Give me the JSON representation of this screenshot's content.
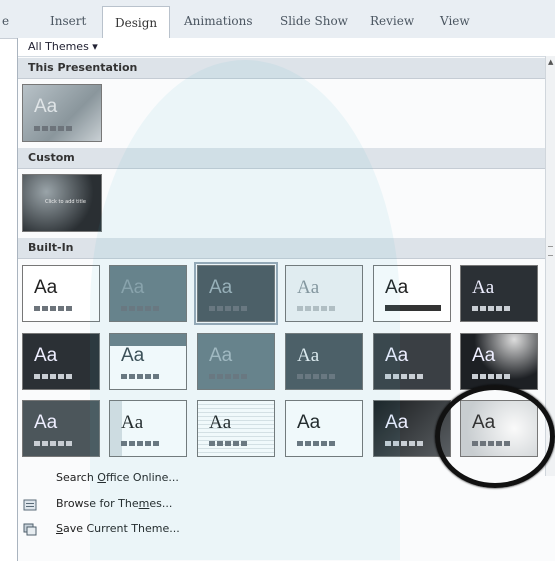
{
  "ribbon": {
    "tabs": [
      {
        "label": "e"
      },
      {
        "label": "Insert"
      },
      {
        "label": "Design",
        "active": true
      },
      {
        "label": "Animations"
      },
      {
        "label": "Slide Show"
      },
      {
        "label": "Review"
      },
      {
        "label": "View"
      }
    ]
  },
  "gallery": {
    "filter_label": "All Themes ▾",
    "sections": {
      "this_presentation": "This Presentation",
      "custom": "Custom",
      "built_in": "Built-In"
    },
    "thumb_label": "Aa",
    "custom_thumb_text": "Click to add title"
  },
  "menu": {
    "search": {
      "before": "Search ",
      "accel": "O",
      "after": "ffice Online..."
    },
    "browse": {
      "before": "Browse for The",
      "accel": "m",
      "after": "es..."
    },
    "save": {
      "before": "",
      "accel": "S",
      "after": "ave Current Theme..."
    }
  },
  "colors": {
    "accent_border": "#9aa8b5",
    "section_bg": "#dde3e9"
  }
}
